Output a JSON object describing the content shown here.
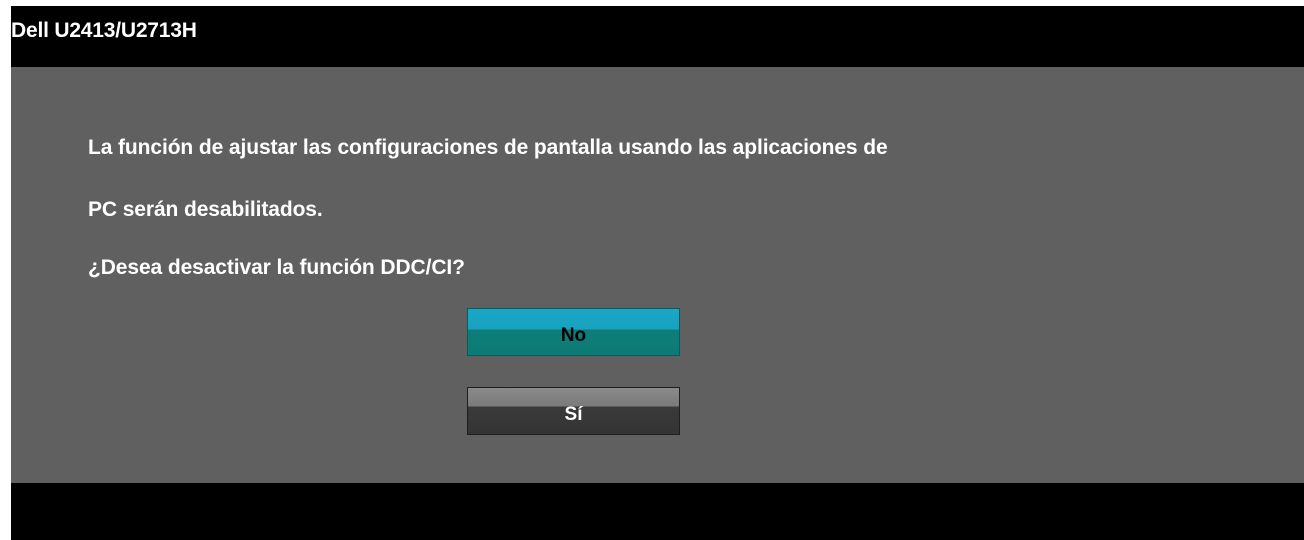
{
  "window": {
    "title": "Dell U2413/U2713H"
  },
  "dialog": {
    "message_line_1": "La función de ajustar las configuraciones de pantalla usando las aplicaciones de",
    "message_line_2": "PC serán desabilitados.",
    "question": "¿Desea desactivar la función DDC/CI?",
    "buttons": {
      "no_label": "No",
      "yes_label": "Sí"
    },
    "selected_button": "No"
  },
  "colors": {
    "header_bg": "#000000",
    "body_bg": "#606060",
    "selected_button": "#1aa6c6",
    "unselected_button": "#3a3a3a",
    "text": "#ffffff"
  }
}
